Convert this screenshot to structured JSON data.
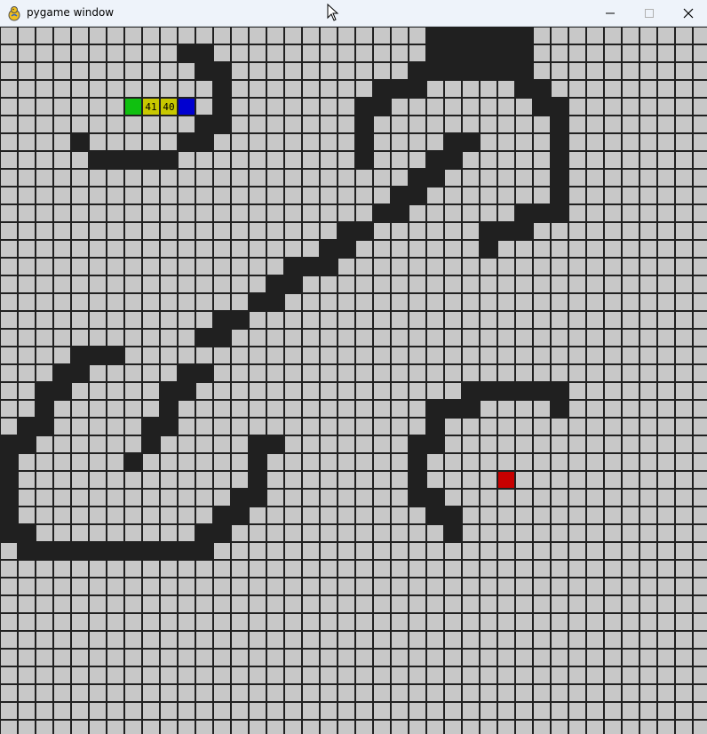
{
  "window": {
    "title": "pygame window",
    "controls": {
      "minimize_icon": "minimize-icon",
      "maximize_icon": "maximize-icon",
      "close_icon": "close-icon"
    }
  },
  "game": {
    "grid_cols": 40,
    "grid_rows": 40,
    "colors": {
      "empty": "#c8c8c8",
      "wall": "#202020",
      "start": "#10c010",
      "end": "#0000d0",
      "path": "#c8c800",
      "target": "#c80000",
      "grid_line": "#202020"
    },
    "start": [
      7,
      4
    ],
    "end": [
      10,
      4
    ],
    "target": [
      28,
      25
    ],
    "path_cells": [
      {
        "cell": [
          8,
          4
        ],
        "label": "41"
      },
      {
        "cell": [
          9,
          4
        ],
        "label": "40"
      }
    ],
    "walls": [
      [
        10,
        1
      ],
      [
        11,
        1
      ],
      [
        11,
        2
      ],
      [
        12,
        2
      ],
      [
        12,
        3
      ],
      [
        12,
        4
      ],
      [
        12,
        5
      ],
      [
        11,
        5
      ],
      [
        10,
        6
      ],
      [
        11,
        6
      ],
      [
        4,
        6
      ],
      [
        5,
        7
      ],
      [
        6,
        7
      ],
      [
        7,
        7
      ],
      [
        8,
        7
      ],
      [
        9,
        7
      ],
      [
        24,
        0
      ],
      [
        25,
        0
      ],
      [
        26,
        0
      ],
      [
        27,
        0
      ],
      [
        28,
        0
      ],
      [
        29,
        0
      ],
      [
        24,
        1
      ],
      [
        25,
        1
      ],
      [
        26,
        1
      ],
      [
        27,
        1
      ],
      [
        28,
        1
      ],
      [
        29,
        1
      ],
      [
        23,
        2
      ],
      [
        24,
        2
      ],
      [
        25,
        2
      ],
      [
        26,
        2
      ],
      [
        27,
        2
      ],
      [
        28,
        2
      ],
      [
        29,
        2
      ],
      [
        21,
        3
      ],
      [
        22,
        3
      ],
      [
        23,
        3
      ],
      [
        29,
        3
      ],
      [
        30,
        3
      ],
      [
        20,
        4
      ],
      [
        21,
        4
      ],
      [
        30,
        4
      ],
      [
        31,
        4
      ],
      [
        20,
        5
      ],
      [
        31,
        5
      ],
      [
        20,
        6
      ],
      [
        25,
        6
      ],
      [
        26,
        6
      ],
      [
        31,
        6
      ],
      [
        20,
        7
      ],
      [
        24,
        7
      ],
      [
        25,
        7
      ],
      [
        31,
        7
      ],
      [
        23,
        8
      ],
      [
        24,
        8
      ],
      [
        31,
        8
      ],
      [
        22,
        9
      ],
      [
        23,
        9
      ],
      [
        31,
        9
      ],
      [
        21,
        10
      ],
      [
        22,
        10
      ],
      [
        29,
        10
      ],
      [
        30,
        10
      ],
      [
        31,
        10
      ],
      [
        19,
        11
      ],
      [
        20,
        11
      ],
      [
        27,
        11
      ],
      [
        28,
        11
      ],
      [
        29,
        11
      ],
      [
        18,
        12
      ],
      [
        19,
        12
      ],
      [
        27,
        12
      ],
      [
        16,
        13
      ],
      [
        17,
        13
      ],
      [
        18,
        13
      ],
      [
        15,
        14
      ],
      [
        16,
        14
      ],
      [
        14,
        15
      ],
      [
        15,
        15
      ],
      [
        12,
        16
      ],
      [
        13,
        16
      ],
      [
        11,
        17
      ],
      [
        12,
        17
      ],
      [
        4,
        18
      ],
      [
        5,
        18
      ],
      [
        6,
        18
      ],
      [
        3,
        19
      ],
      [
        4,
        19
      ],
      [
        10,
        19
      ],
      [
        11,
        19
      ],
      [
        2,
        20
      ],
      [
        3,
        20
      ],
      [
        9,
        20
      ],
      [
        10,
        20
      ],
      [
        2,
        21
      ],
      [
        9,
        21
      ],
      [
        1,
        22
      ],
      [
        2,
        22
      ],
      [
        8,
        22
      ],
      [
        9,
        22
      ],
      [
        0,
        23
      ],
      [
        1,
        23
      ],
      [
        8,
        23
      ],
      [
        0,
        24
      ],
      [
        7,
        24
      ],
      [
        0,
        25
      ],
      [
        0,
        26
      ],
      [
        0,
        27
      ],
      [
        0,
        28
      ],
      [
        1,
        28
      ],
      [
        1,
        29
      ],
      [
        2,
        29
      ],
      [
        3,
        29
      ],
      [
        4,
        29
      ],
      [
        5,
        29
      ],
      [
        6,
        29
      ],
      [
        7,
        29
      ],
      [
        8,
        29
      ],
      [
        9,
        29
      ],
      [
        10,
        29
      ],
      [
        11,
        29
      ],
      [
        14,
        23
      ],
      [
        15,
        23
      ],
      [
        14,
        24
      ],
      [
        14,
        25
      ],
      [
        13,
        26
      ],
      [
        14,
        26
      ],
      [
        12,
        27
      ],
      [
        13,
        27
      ],
      [
        11,
        28
      ],
      [
        12,
        28
      ],
      [
        26,
        20
      ],
      [
        27,
        20
      ],
      [
        28,
        20
      ],
      [
        29,
        20
      ],
      [
        30,
        20
      ],
      [
        31,
        20
      ],
      [
        24,
        21
      ],
      [
        25,
        21
      ],
      [
        26,
        21
      ],
      [
        31,
        21
      ],
      [
        24,
        22
      ],
      [
        23,
        23
      ],
      [
        24,
        23
      ],
      [
        23,
        24
      ],
      [
        23,
        25
      ],
      [
        23,
        26
      ],
      [
        24,
        26
      ],
      [
        24,
        27
      ],
      [
        25,
        27
      ],
      [
        25,
        28
      ]
    ]
  }
}
